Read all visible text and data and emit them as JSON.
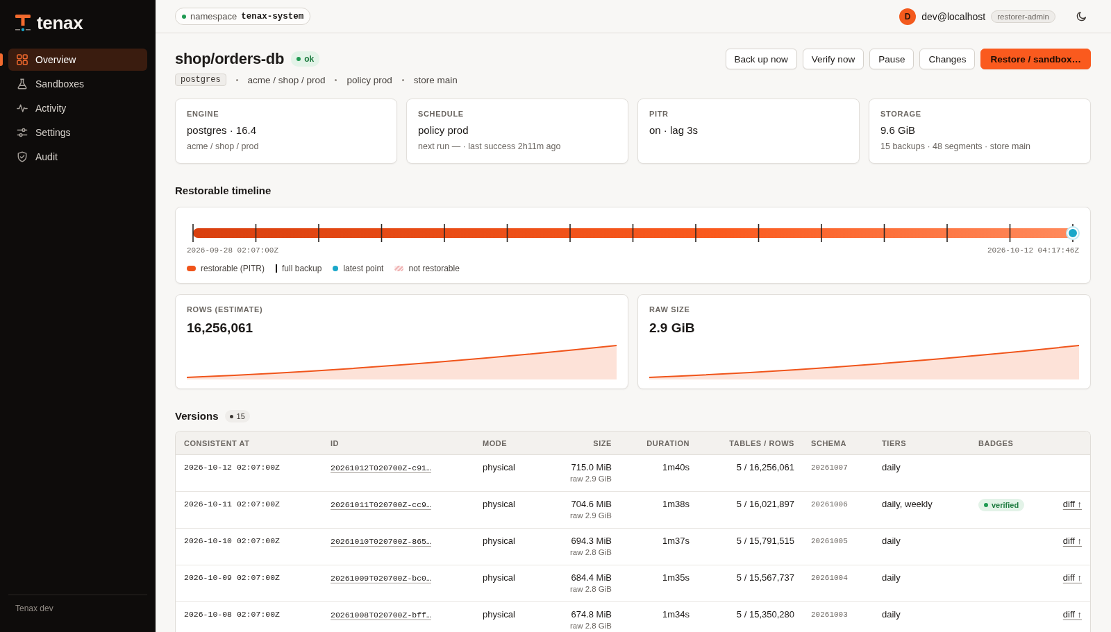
{
  "sidebar": {
    "brand": "tenax",
    "items": [
      {
        "label": "Overview",
        "selected": true
      },
      {
        "label": "Sandboxes",
        "selected": false
      },
      {
        "label": "Activity",
        "selected": false
      },
      {
        "label": "Settings",
        "selected": false
      },
      {
        "label": "Audit",
        "selected": false
      }
    ],
    "footer": "Tenax dev"
  },
  "topbar": {
    "namespace": {
      "label": "namespace",
      "value": "tenax-system"
    },
    "user": {
      "initial": "D",
      "email": "dev@localhost",
      "role": "restorer-admin"
    }
  },
  "header": {
    "title": "shop/orders-db",
    "status": {
      "label": "ok",
      "kind": "ok"
    },
    "engine_tag": "postgres",
    "meta": [
      "acme / shop / prod",
      "policy prod",
      "store main"
    ],
    "buttons": [
      {
        "label": "Back up now",
        "primary": false
      },
      {
        "label": "Verify now",
        "primary": false
      },
      {
        "label": "Pause",
        "primary": false
      },
      {
        "label": "Changes",
        "primary": false
      },
      {
        "label": "Restore / sandbox…",
        "primary": true
      }
    ]
  },
  "summary_cards": [
    {
      "label": "ENGINE",
      "value": "postgres · 16.4",
      "detail": "acme / shop / prod"
    },
    {
      "label": "SCHEDULE",
      "value": "policy prod",
      "detail": "next run — · last success 2h11m ago"
    },
    {
      "label": "PITR",
      "value": "on · lag 3s"
    },
    {
      "label": "STORAGE",
      "value": "9.6 GiB",
      "detail": "15 backups · 48 segments · store main"
    }
  ],
  "timeline": {
    "title": "Restorable timeline",
    "start": "2026-09-28 02:07:00Z",
    "end": "2026-10-12 04:17:46Z",
    "legend": [
      {
        "label": "restorable (PITR)",
        "kind": "range",
        "color": "#f0541a"
      },
      {
        "label": "full backup",
        "kind": "tick",
        "color": "#1c1917"
      },
      {
        "label": "latest point",
        "kind": "dot",
        "color": "#1aa7c9"
      },
      {
        "label": "not restorable",
        "kind": "hatch",
        "color": "#f0b4b4"
      }
    ]
  },
  "metrics": [
    {
      "label": "ROWS (ESTIMATE)",
      "value": "16,256,061"
    },
    {
      "label": "RAW SIZE",
      "value": "2.9 GiB"
    }
  ],
  "versions": {
    "title": "Versions",
    "count": "15",
    "columns": [
      "CONSISTENT AT",
      "ID",
      "MODE",
      "SIZE",
      "DURATION",
      "TABLES / ROWS",
      "SCHEMA",
      "TIERS",
      "BADGES"
    ],
    "rows": [
      {
        "consistent_at": "2026-10-12 02:07:00Z",
        "id": "20261012T020700Z-c91…",
        "mode": "physical",
        "size": "715.0 MiB",
        "raw": "raw 2.9 GiB",
        "duration": "1m40s",
        "tables_rows": "5 / 16,256,061",
        "schema": "20261007",
        "tiers": "daily"
      },
      {
        "consistent_at": "2026-10-11 02:07:00Z",
        "id": "20261011T020700Z-cc9…",
        "mode": "physical",
        "size": "704.6 MiB",
        "raw": "raw 2.9 GiB",
        "duration": "1m38s",
        "tables_rows": "5 / 16,021,897",
        "schema": "20261006",
        "tiers": "daily, weekly",
        "badges": [
          {
            "label": "verified",
            "kind": "verified"
          }
        ],
        "diff": "diff ↑"
      },
      {
        "consistent_at": "2026-10-10 02:07:00Z",
        "id": "20261010T020700Z-865…",
        "mode": "physical",
        "size": "694.3 MiB",
        "raw": "raw 2.8 GiB",
        "duration": "1m37s",
        "tables_rows": "5 / 15,791,515",
        "schema": "20261005",
        "tiers": "daily",
        "diff": "diff ↑"
      },
      {
        "consistent_at": "2026-10-09 02:07:00Z",
        "id": "20261009T020700Z-bc0…",
        "mode": "physical",
        "size": "684.4 MiB",
        "raw": "raw 2.8 GiB",
        "duration": "1m35s",
        "tables_rows": "5 / 15,567,737",
        "schema": "20261004",
        "tiers": "daily",
        "diff": "diff ↑"
      },
      {
        "consistent_at": "2026-10-08 02:07:00Z",
        "id": "20261008T020700Z-bff…",
        "mode": "physical",
        "size": "674.8 MiB",
        "raw": "raw 2.8 GiB",
        "duration": "1m34s",
        "tables_rows": "5 / 15,350,280",
        "schema": "20261003",
        "tiers": "daily",
        "diff": "diff ↑"
      }
    ]
  }
}
